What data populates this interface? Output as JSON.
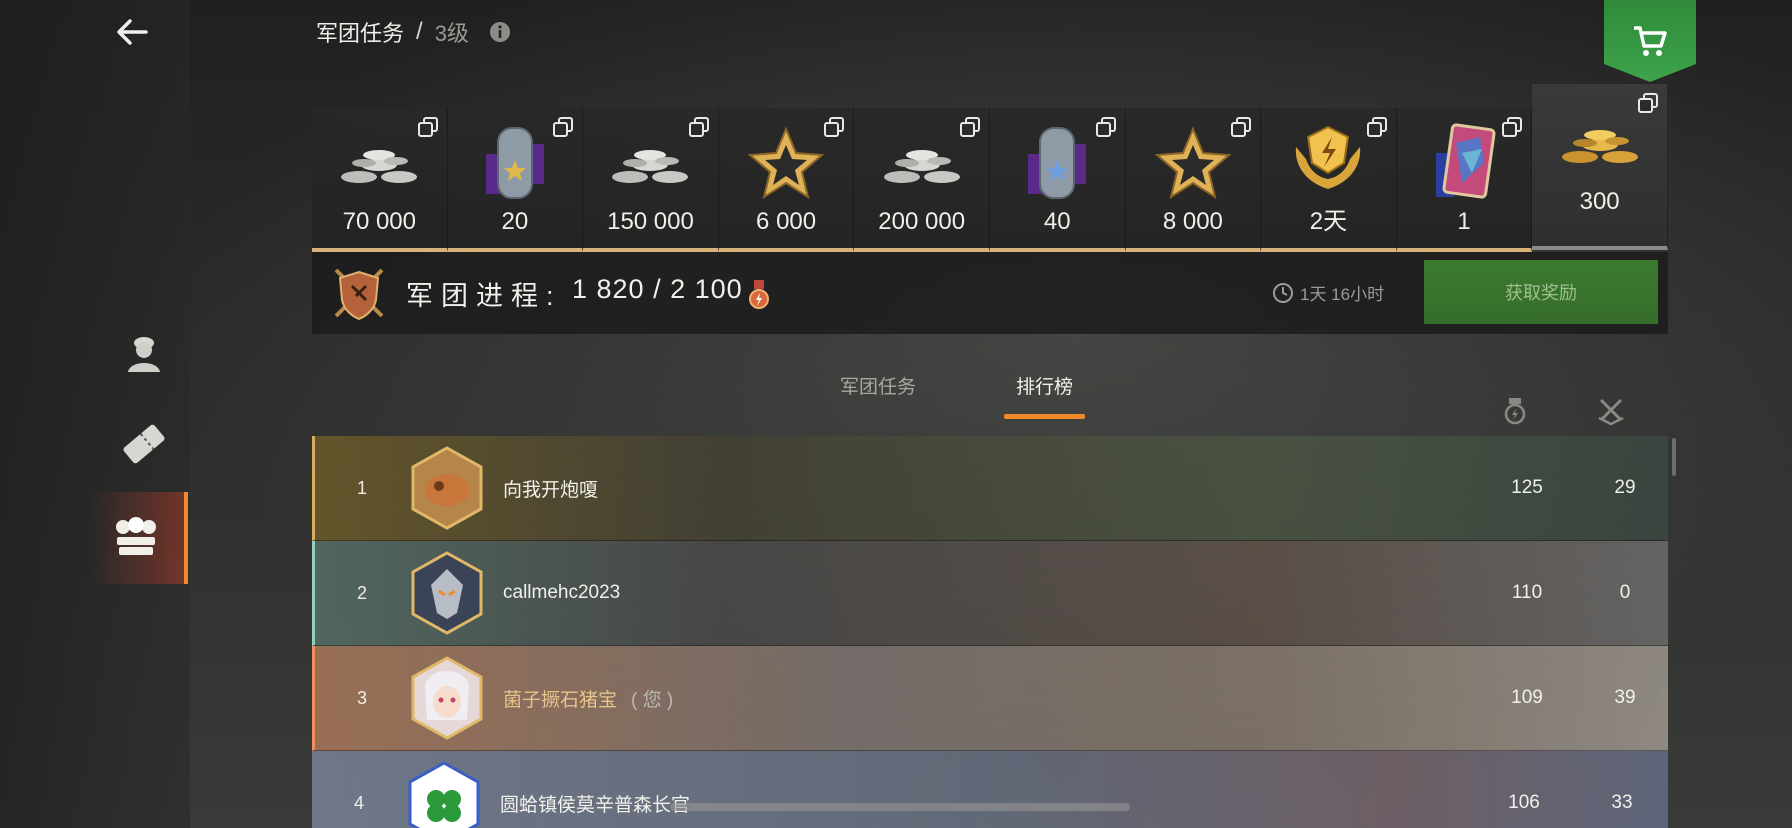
{
  "header": {
    "title": "军团任务",
    "separator": "/",
    "level": "3级"
  },
  "rewards": [
    {
      "value": "70 000",
      "icon": "silver-coins-icon"
    },
    {
      "value": "20",
      "icon": "tank-badge-gold-star-icon"
    },
    {
      "value": "150 000",
      "icon": "silver-coins-icon"
    },
    {
      "value": "6 000",
      "icon": "gold-star-icon"
    },
    {
      "value": "200 000",
      "icon": "silver-coins-icon"
    },
    {
      "value": "40",
      "icon": "tank-badge-blue-star-icon"
    },
    {
      "value": "8 000",
      "icon": "gold-star-icon"
    },
    {
      "value": "2天",
      "icon": "premium-emblem-icon"
    },
    {
      "value": "1",
      "icon": "card-icon"
    },
    {
      "value": "300",
      "icon": "gold-coins-icon"
    }
  ],
  "progress": {
    "label": "军团进程:",
    "value": "1 820 / 2 100",
    "timer": "1天 16小时",
    "claim_label": "获取奖励"
  },
  "tabs": [
    {
      "label": "军团任务",
      "active": false
    },
    {
      "label": "排行榜",
      "active": true
    }
  ],
  "leaderboard": [
    {
      "rank": "1",
      "name": "向我开炮嗄",
      "you": "",
      "score": "125",
      "kills": "29"
    },
    {
      "rank": "2",
      "name": "callmehc2023",
      "you": "",
      "score": "110",
      "kills": "0"
    },
    {
      "rank": "3",
      "name": "菌子撅石猪宝",
      "you": "( 您 )",
      "score": "109",
      "kills": "39"
    },
    {
      "rank": "4",
      "name": "圆蛤镇侯莫辛普森长官",
      "you": "",
      "score": "106",
      "kills": "33"
    }
  ],
  "colors": {
    "accent": "#f08a2b",
    "claim_green": "#3c7a30",
    "shop_green": "#3ea44a",
    "you_name": "#e6c38a"
  }
}
